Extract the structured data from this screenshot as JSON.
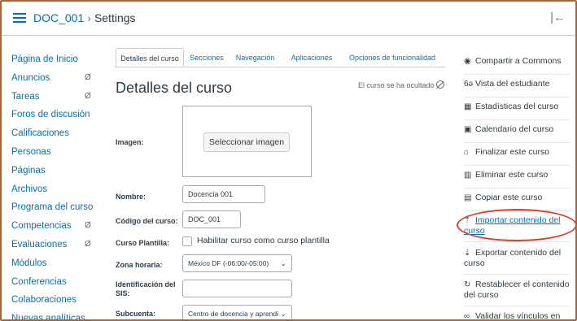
{
  "breadcrumb": {
    "course": "DOC_001",
    "separator": "›",
    "current": "Settings"
  },
  "nav": [
    {
      "label": "Página de Inicio",
      "hidden": false
    },
    {
      "label": "Anuncios",
      "hidden": true
    },
    {
      "label": "Tareas",
      "hidden": true
    },
    {
      "label": "Foros de discusión",
      "hidden": false
    },
    {
      "label": "Calificaciones",
      "hidden": false
    },
    {
      "label": "Personas",
      "hidden": false
    },
    {
      "label": "Páginas",
      "hidden": false
    },
    {
      "label": "Archivos",
      "hidden": false
    },
    {
      "label": "Programa del curso",
      "hidden": false
    },
    {
      "label": "Competencias",
      "hidden": true
    },
    {
      "label": "Evaluaciones",
      "hidden": true
    },
    {
      "label": "Módulos",
      "hidden": false
    },
    {
      "label": "Conferencias",
      "hidden": false
    },
    {
      "label": "Colaboraciones",
      "hidden": false
    },
    {
      "label": "Nuevas analíticas",
      "hidden": false
    }
  ],
  "tabs": [
    "Detalles del curso",
    "Secciones",
    "Navegación",
    "Aplicaciones",
    "Opciones de funcionalidad"
  ],
  "active_tab": "Detalles del curso",
  "page_title": "Detalles del curso",
  "hidden_note": "El curso se ha ocultado",
  "form": {
    "image_label": "Imagen:",
    "select_image": "Seleccionar imagen",
    "name_label": "Nombre:",
    "name_value": "Docencia 001",
    "code_label": "Código del curso:",
    "code_value": "DOC_001",
    "template_label": "Curso Plantilla:",
    "template_checkbox": "Habilitar curso como curso plantilla",
    "timezone_label": "Zona horaria:",
    "timezone_value": "México DF (-06:00/-05:00)",
    "sis_label": "Identificación del SIS:",
    "sis_value": "",
    "subaccount_label": "Subcuenta:",
    "subaccount_value": "Centro de docencia y aprendi"
  },
  "sidebar_actions": [
    {
      "icon": "eye-icon",
      "glyph": "◉",
      "label": "Compartir a Commons",
      "link": false
    },
    {
      "icon": "student-view-icon",
      "glyph": "6ə",
      "label": "Vista del estudiante",
      "link": false
    },
    {
      "icon": "stats-icon",
      "glyph": "▦",
      "label": "Estadísticas del curso",
      "link": false
    },
    {
      "icon": "calendar-icon",
      "glyph": "▣",
      "label": "Calendario del curso",
      "link": false
    },
    {
      "icon": "lock-icon",
      "glyph": "⌂",
      "label": "Finalizar este curso",
      "link": false
    },
    {
      "icon": "trash-icon",
      "glyph": "▥",
      "label": "Eliminar este curso",
      "link": false
    },
    {
      "icon": "copy-icon",
      "glyph": "▤",
      "label": "Copiar este curso",
      "link": false
    },
    {
      "icon": "upload-icon",
      "glyph": "⇡",
      "label": "Importar contenido del curso",
      "link": true
    },
    {
      "icon": "download-icon",
      "glyph": "⇣",
      "label": "Exportar contenido del curso",
      "link": false
    },
    {
      "icon": "reset-icon",
      "glyph": "↻",
      "label": "Restablecer el contenido del curso",
      "link": false
    },
    {
      "icon": "link-icon",
      "glyph": "∞",
      "label": "Validar los vínculos en",
      "link": false
    }
  ]
}
